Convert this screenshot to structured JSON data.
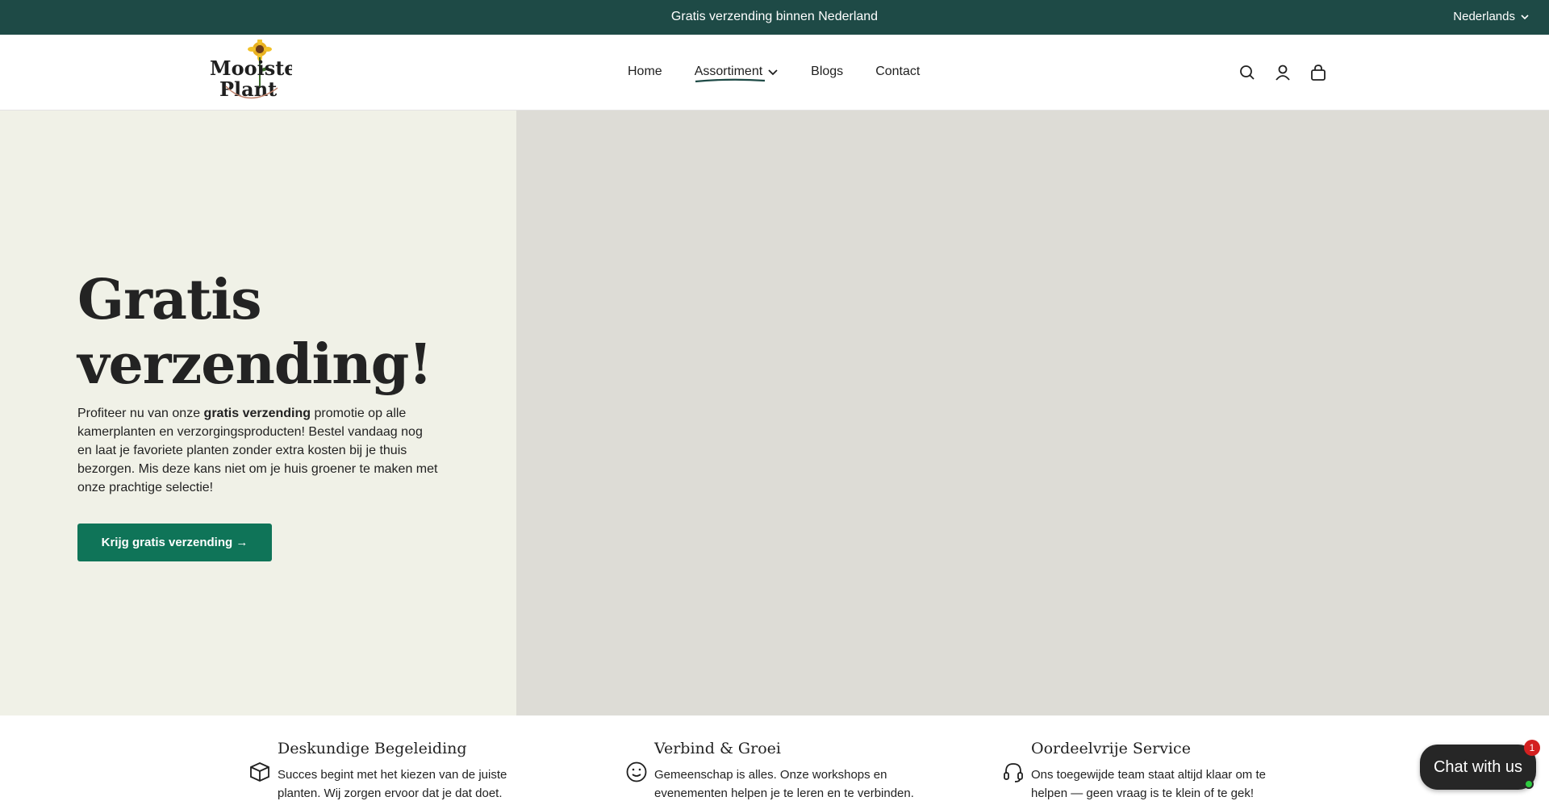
{
  "announcement": {
    "text": "Gratis verzending binnen Nederland",
    "language": "Nederlands"
  },
  "header": {
    "logo": {
      "line1": "Mooiste",
      "line2": "Plant"
    },
    "nav": [
      {
        "label": "Home"
      },
      {
        "label": "Assortiment",
        "has_dropdown": true
      },
      {
        "label": "Blogs"
      },
      {
        "label": "Contact"
      }
    ],
    "icons": [
      "search-icon",
      "account-icon",
      "cart-icon"
    ]
  },
  "hero": {
    "title": "Gratis verzending!",
    "text_before": "Profiteer nu van onze ",
    "text_bold": "gratis verzending",
    "text_after": " promotie op alle kamerplanten en verzorgingsproducten! Bestel vandaag nog en laat je favoriete planten zonder extra kosten bij je thuis bezorgen. Mis deze kans niet om je huis groener te maken met onze prachtige selectie!",
    "button": "Krijg gratis verzending →"
  },
  "features": [
    {
      "icon": "box-icon",
      "title": "Deskundige Begeleiding",
      "text": "Succes begint met het kiezen van de juiste planten. Wij zorgen ervoor dat je dat doet."
    },
    {
      "icon": "smile-icon",
      "title": "Verbind & Groei",
      "text": "Gemeenschap is alles. Onze workshops en evenementen helpen je te leren en te verbinden."
    },
    {
      "icon": "headset-icon",
      "title": "Oordeelvrije Service",
      "text": "Ons toegewijde team staat altijd klaar om te helpen — geen vraag is te klein of te gek!"
    }
  ],
  "chat": {
    "label": "Chat with us",
    "badge": "1"
  },
  "colors": {
    "announcement_bg": "#1e4a46",
    "hero_left_bg": "#f0f1e7",
    "hero_right_bg": "#dddcd6",
    "button_bg": "#0f7458"
  }
}
